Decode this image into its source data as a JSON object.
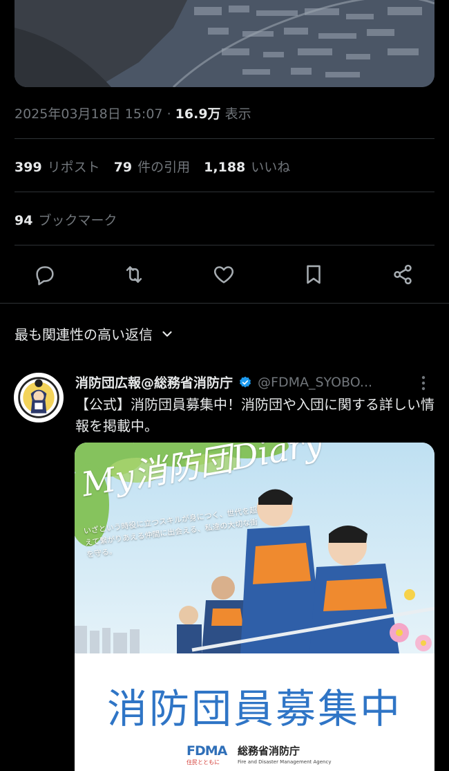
{
  "tweet": {
    "timestamp": "2025年03月18日 15:07",
    "separator": "·",
    "views_count": "16.9万",
    "views_label": "表示",
    "reposts_count": "399",
    "reposts_label": "リポスト",
    "quotes_count": "79",
    "quotes_label": "件の引用",
    "likes_count": "1,188",
    "likes_label": "いいね",
    "bookmarks_count": "94",
    "bookmarks_label": "ブックマーク"
  },
  "actions": {
    "icons": [
      "reply-icon",
      "repost-icon",
      "like-icon",
      "bookmark-icon",
      "share-icon"
    ]
  },
  "replies": {
    "sort_label": "最も関連性の高い返信"
  },
  "reply": {
    "name": "消防団広報@総務省消防庁",
    "handle": "@FDMA_SYOBO...",
    "text": "【公式】消防団員募集中！消防団や入団に関する詳しい情報を掲載中。",
    "poster": {
      "script_title": "My消防団Diary",
      "tagline": "いざという時役に立つスキルが身につく、世代を超えて繋がりあえる仲間に出会える、私達の大切な街を守る。",
      "headline": "消防団員募集中",
      "logo_text": "FDMA",
      "logo_sub": "住民とともに",
      "agency_jp": "総務省消防庁",
      "agency_en": "Fire and Disaster Management Agency"
    }
  },
  "colors": {
    "background": "#000000",
    "text_primary": "#e7e9ea",
    "text_secondary": "#71767b",
    "divider": "#2f3336",
    "verified": "#1d9bf0",
    "poster_blue": "#2f75c6"
  }
}
